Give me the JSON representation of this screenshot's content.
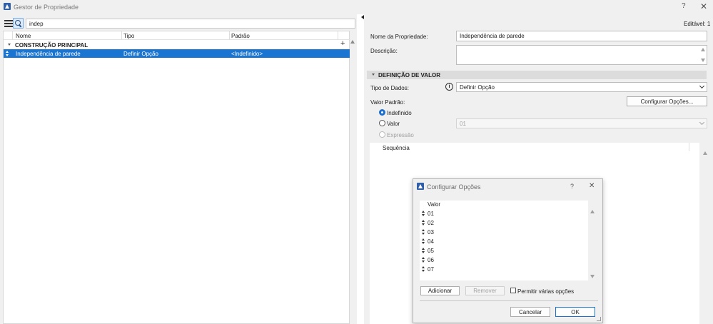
{
  "window": {
    "title": "Gestor de Propriedade",
    "help": "?",
    "close": "✕"
  },
  "search": {
    "value": "indep",
    "placeholder": ""
  },
  "tree": {
    "columns": {
      "name": "Nome",
      "type": "Tipo",
      "default": "Padrão"
    },
    "add": "+",
    "group": "CONSTRUÇÃO PRINCIPAL",
    "rows": [
      {
        "name": "Independência de parede",
        "type": "Definir Opção",
        "default": "<Indefinido>"
      }
    ]
  },
  "editable": "Editável: 1",
  "details": {
    "property_name_label": "Nome da Propriedade:",
    "property_name_value": "Independência de parede",
    "description_label": "Descrição:",
    "description_value": "",
    "section_title": "DEFINIÇÃO DE VALOR",
    "data_type_label": "Tipo de Dados:",
    "data_type_value": "Definir Opção",
    "info": "i",
    "default_value_label": "Valor Padrão:",
    "configure_button": "Configurar Opções...",
    "radio_undefined": "Indefinido",
    "radio_value": "Valor",
    "value_select": "01",
    "radio_expression": "Expressão",
    "sequence_header": "Sequência"
  },
  "dialog": {
    "title": "Configurar Opções",
    "help": "?",
    "close": "✕",
    "list_header": "Valor",
    "options": [
      "01",
      "02",
      "03",
      "04",
      "05",
      "06",
      "07"
    ],
    "add_button": "Adicionar",
    "remove_button": "Remover",
    "allow_multiple": "Permitir várias opções",
    "cancel_button": "Cancelar",
    "ok_button": "OK"
  },
  "colors": {
    "selection": "#1a75d2",
    "panel": "#f0f0f0",
    "section_bar": "#dcdcdc"
  },
  "icons": [
    "app-logo-icon",
    "list-view-icon",
    "search-icon",
    "plus-icon",
    "info-icon",
    "grip-icon",
    "chevron-down-icon",
    "close-icon",
    "help-icon"
  ]
}
